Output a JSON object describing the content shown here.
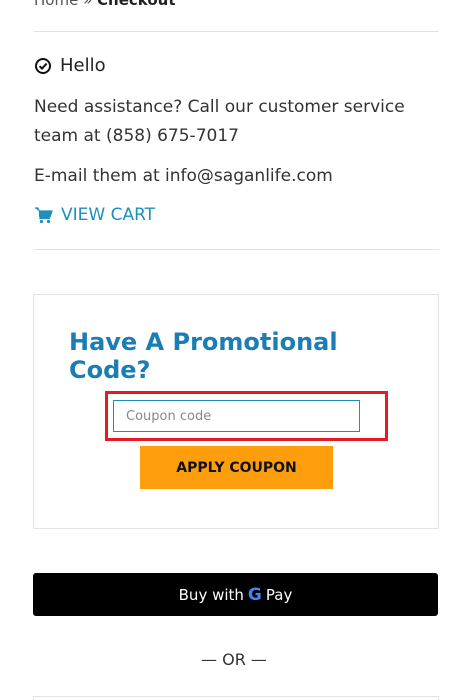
{
  "breadcrumb": {
    "home": "Home",
    "separator": "»",
    "current": "Checkout"
  },
  "greeting": "Hello",
  "assistance_text": "Need assistance? Call our customer service team at (858) 675-7017",
  "email_text": "E-mail them at info@saganlife.com",
  "view_cart_label": "VIEW CART",
  "promo": {
    "title": "Have A Promotional Code?",
    "coupon_placeholder": "Coupon code",
    "apply_label": "APPLY COUPON"
  },
  "gpay": {
    "label": "Buy with",
    "g": "G",
    "pay": "Pay"
  },
  "or_divider": "— OR —",
  "colors": {
    "accent": "#1d8fbf",
    "promo_title": "#1b7db3",
    "apply_button": "#ff9e0d",
    "highlight": "#e21b25",
    "gpay_background": "#000000"
  },
  "icons": {
    "greeting": "check-circle-icon",
    "cart": "shopping-cart-icon",
    "google": "google-g-icon"
  }
}
